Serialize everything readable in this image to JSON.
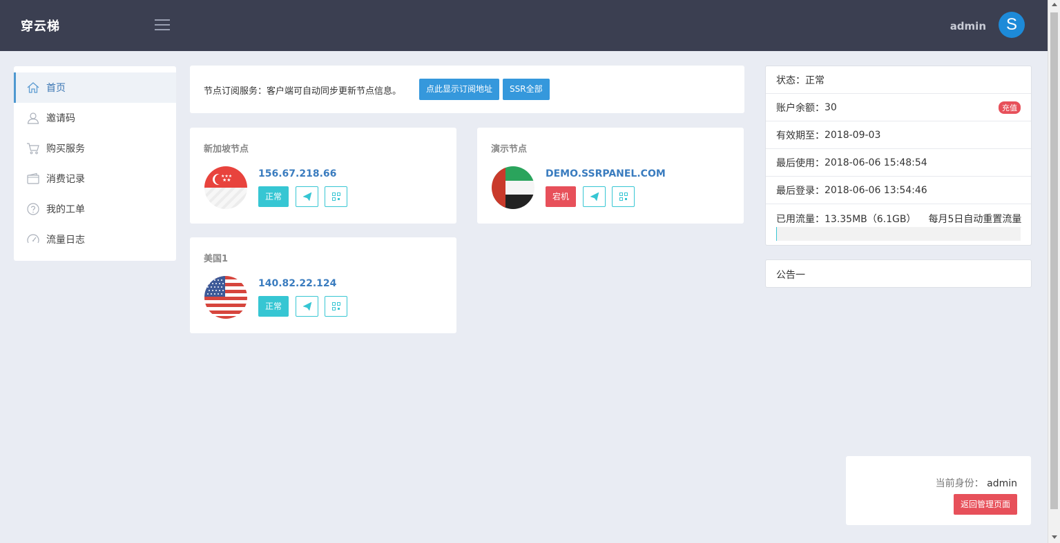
{
  "header": {
    "logo": "穿云梯",
    "username": "admin",
    "avatar_letter": "S"
  },
  "sidebar": {
    "items": [
      {
        "label": "首页",
        "icon": "home-icon",
        "active": true
      },
      {
        "label": "邀请码",
        "icon": "user-icon",
        "active": false
      },
      {
        "label": "购买服务",
        "icon": "cart-icon",
        "active": false
      },
      {
        "label": "消费记录",
        "icon": "wallet-icon",
        "active": false
      },
      {
        "label": "我的工单",
        "icon": "question-icon",
        "active": false
      },
      {
        "label": "流量日志",
        "icon": "speedometer-icon",
        "active": false
      }
    ]
  },
  "subscribe": {
    "text": "节点订阅服务：客户端可自动同步更新节点信息。",
    "show_button": "点此显示订阅地址",
    "ssr_all_button": "SSR全部"
  },
  "nodes": [
    {
      "title": "新加坡节点",
      "address": "156.67.218.66",
      "status": "正常",
      "status_color": "#36c6d3",
      "flag": "singapore-flag"
    },
    {
      "title": "演示节点",
      "address": "DEMO.SSRPANEL.COM",
      "status": "宕机",
      "status_color": "#e7505a",
      "flag": "uae-flag"
    },
    {
      "title": "美国1",
      "address": "140.82.22.124",
      "status": "正常",
      "status_color": "#36c6d3",
      "flag": "usa-flag"
    }
  ],
  "account": {
    "status_label": "状态：",
    "status_value": "正常",
    "balance_label": "账户余额：",
    "balance_value": "30",
    "recharge": "充值",
    "expire_label": "有效期至：",
    "expire_value": "2018-09-03",
    "last_used_label": "最后使用：",
    "last_used_value": "2018-06-06 15:48:54",
    "last_login_label": "最后登录：",
    "last_login_value": "2018-06-06 13:54:46",
    "traffic_label": "已用流量：",
    "traffic_value": "13.35MB（6.1GB）",
    "traffic_reset": "每月5日自动重置流量",
    "traffic_progress": 0.002
  },
  "notice": {
    "title": "公告一"
  },
  "identity": {
    "label": "当前身份：",
    "name": "admin",
    "back_button": "返回管理页面"
  },
  "colors": {
    "topbar": "#3b3f51",
    "accent": "#3598dc",
    "ok": "#36c6d3",
    "danger": "#e7505a"
  }
}
